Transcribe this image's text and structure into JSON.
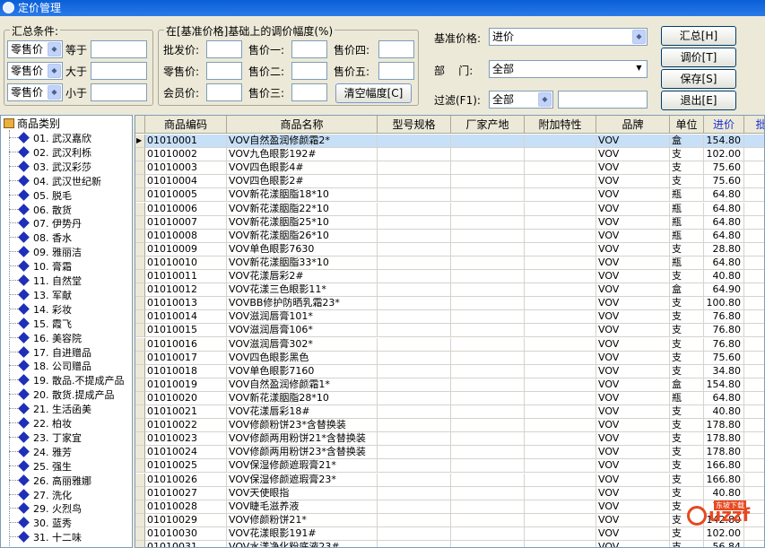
{
  "window": {
    "title": "定价管理"
  },
  "summary": {
    "title": "汇总条件:",
    "rows": [
      {
        "field": "零售价",
        "op": "等于"
      },
      {
        "field": "零售价",
        "op": "大于"
      },
      {
        "field": "零售价",
        "op": "小于"
      }
    ]
  },
  "adjust": {
    "title": "在[基准价格]基础上的调价幅度(%)",
    "labels": {
      "wholesale": "批发价:",
      "retail": "零售价:",
      "member": "会员价:",
      "p1": "售价一:",
      "p2": "售价二:",
      "p3": "售价三:",
      "p4": "售价四:",
      "p5": "售价五:"
    },
    "clear_label": "清空幅度[C]"
  },
  "filters": {
    "base_price_label": "基准价格:",
    "base_price_value": "进价",
    "dept_label": "部    门:",
    "dept_value": "全部",
    "filter_label": "过滤(F1):",
    "filter_value": "全部"
  },
  "buttons": {
    "summary": "汇总[H]",
    "adjust": "调价[T]",
    "save": "保存[S]",
    "exit": "退出[E]"
  },
  "tree": {
    "root": "商品类别",
    "items": [
      "01. 武汉嘉欣",
      "02. 武汉利栎",
      "03. 武汉彩莎",
      "04. 武汉世纪新",
      "05. 脱毛",
      "06. 散货",
      "07. 伊势丹",
      "08. 香水",
      "09. 雅丽洁",
      "10. 膏霜",
      "11. 自然堂",
      "13. 军献",
      "14. 彩妆",
      "15. 霞飞",
      "16. 美容院",
      "17. 自进赠品",
      "18. 公司赠品",
      "19. 散品.不提成产品",
      "20. 散货.提成产品",
      "21. 生活函美",
      "22. 柏妆",
      "23. 丁家宜",
      "24. 雅芳",
      "25. 强生",
      "26. 高丽雅娜",
      "27. 洗化",
      "29. 火烈鸟",
      "30. 蓝秀",
      "31. 十二味"
    ]
  },
  "grid": {
    "columns": [
      "商品编码",
      "商品名称",
      "型号规格",
      "厂家产地",
      "附加特性",
      "品牌",
      "单位",
      "进价",
      "批发"
    ],
    "rows": [
      {
        "code": "01010001",
        "name": "VOV自然盈润修颜霜2*",
        "brand": "VOV",
        "unit": "盒",
        "price": "154.80"
      },
      {
        "code": "01010002",
        "name": "VOV九色眼影192#",
        "brand": "VOV",
        "unit": "支",
        "price": "102.00"
      },
      {
        "code": "01010003",
        "name": "VOV四色眼影4#",
        "brand": "VOV",
        "unit": "支",
        "price": "75.60"
      },
      {
        "code": "01010004",
        "name": "VOV四色眼影2#",
        "brand": "VOV",
        "unit": "支",
        "price": "75.60"
      },
      {
        "code": "01010005",
        "name": "VOV新花漾胭脂18*10",
        "brand": "VOV",
        "unit": "瓶",
        "price": "64.80"
      },
      {
        "code": "01010006",
        "name": "VOV新花漾胭脂22*10",
        "brand": "VOV",
        "unit": "瓶",
        "price": "64.80"
      },
      {
        "code": "01010007",
        "name": "VOV新花漾胭脂25*10",
        "brand": "VOV",
        "unit": "瓶",
        "price": "64.80"
      },
      {
        "code": "01010008",
        "name": "VOV新花漾胭脂26*10",
        "brand": "VOV",
        "unit": "瓶",
        "price": "64.80"
      },
      {
        "code": "01010009",
        "name": "VOV单色眼影7630",
        "brand": "VOV",
        "unit": "支",
        "price": "28.80"
      },
      {
        "code": "01010010",
        "name": "VOV新花漾胭脂33*10",
        "brand": "VOV",
        "unit": "瓶",
        "price": "64.80"
      },
      {
        "code": "01010011",
        "name": "VOV花漾唇彩2#",
        "brand": "VOV",
        "unit": "支",
        "price": "40.80"
      },
      {
        "code": "01010012",
        "name": "VOV花漾三色眼影11*",
        "brand": "VOV",
        "unit": "盒",
        "price": "64.90"
      },
      {
        "code": "01010013",
        "name": "VOVBB修护防晒乳霜23*",
        "brand": "VOV",
        "unit": "支",
        "price": "100.80"
      },
      {
        "code": "01010014",
        "name": "VOV滋润唇膏101*",
        "brand": "VOV",
        "unit": "支",
        "price": "76.80"
      },
      {
        "code": "01010015",
        "name": "VOV滋润唇膏106*",
        "brand": "VOV",
        "unit": "支",
        "price": "76.80"
      },
      {
        "code": "01010016",
        "name": "VOV滋润唇膏302*",
        "brand": "VOV",
        "unit": "支",
        "price": "76.80"
      },
      {
        "code": "01010017",
        "name": "VOV四色眼影黑色",
        "brand": "VOV",
        "unit": "支",
        "price": "75.60"
      },
      {
        "code": "01010018",
        "name": "VOV单色眼影7160",
        "brand": "VOV",
        "unit": "支",
        "price": "34.80"
      },
      {
        "code": "01010019",
        "name": "VOV自然盈润修颜霜1*",
        "brand": "VOV",
        "unit": "盒",
        "price": "154.80"
      },
      {
        "code": "01010020",
        "name": "VOV新花漾胭脂28*10",
        "brand": "VOV",
        "unit": "瓶",
        "price": "64.80"
      },
      {
        "code": "01010021",
        "name": "VOV花漾唇彩18#",
        "brand": "VOV",
        "unit": "支",
        "price": "40.80"
      },
      {
        "code": "01010022",
        "name": "VOV修颜粉饼23*含替换装",
        "brand": "VOV",
        "unit": "支",
        "price": "178.80"
      },
      {
        "code": "01010023",
        "name": "VOV修颜两用粉饼21*含替换装",
        "brand": "VOV",
        "unit": "支",
        "price": "178.80"
      },
      {
        "code": "01010024",
        "name": "VOV修颜两用粉饼23*含替换装",
        "brand": "VOV",
        "unit": "支",
        "price": "178.80"
      },
      {
        "code": "01010025",
        "name": "VOV保湿修颜遮瑕膏21*",
        "brand": "VOV",
        "unit": "支",
        "price": "166.80"
      },
      {
        "code": "01010026",
        "name": "VOV保湿修颜遮瑕膏23*",
        "brand": "VOV",
        "unit": "支",
        "price": "166.80"
      },
      {
        "code": "01010027",
        "name": "VOV天使眼指",
        "brand": "VOV",
        "unit": "支",
        "price": "40.80"
      },
      {
        "code": "01010028",
        "name": "VOV睫毛滋养液",
        "brand": "VOV",
        "unit": "支",
        "price": "70.80"
      },
      {
        "code": "01010029",
        "name": "VOV修颜粉饼21*",
        "brand": "VOV",
        "unit": "支",
        "price": "142.80"
      },
      {
        "code": "01010030",
        "name": "VOV花漾眼影191#",
        "brand": "VOV",
        "unit": "支",
        "price": "102.00"
      },
      {
        "code": "01010031",
        "name": "VOV水漾净化粉底液23#",
        "brand": "VOV",
        "unit": "支",
        "price": "56.84"
      }
    ]
  },
  "watermark": {
    "brand": "uzzf",
    "tag": "东坡下载"
  }
}
